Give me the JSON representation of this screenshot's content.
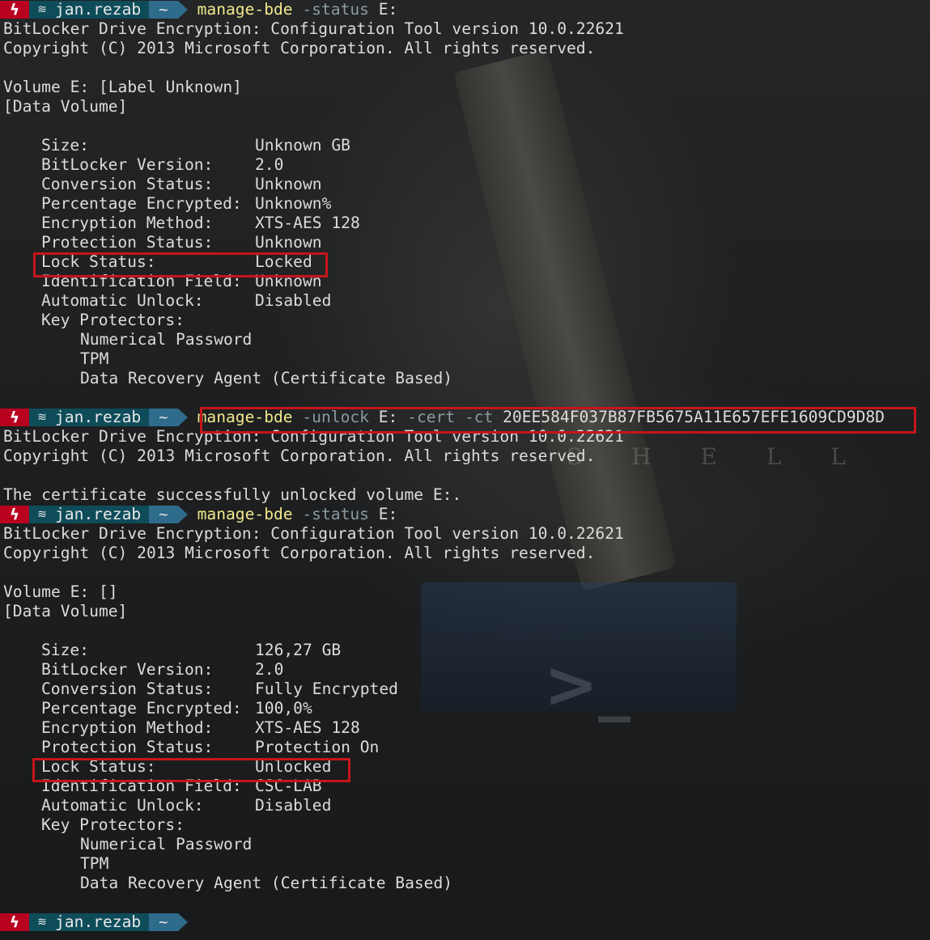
{
  "prompt": {
    "bolt": "ϟ",
    "win": "≋",
    "user": "jan.rezab",
    "home": "~"
  },
  "commands": {
    "status1": {
      "name": "manage-bde",
      "arg": "-status",
      "val": "E:"
    },
    "unlock": {
      "name": "manage-bde",
      "arg1": "-unlock",
      "v1": "E:",
      "arg2": "-cert",
      "arg3": "-ct",
      "v2": "20EE584F037B87FB5675A11E657EFE1609CD9D8D"
    },
    "status2": {
      "name": "manage-bde",
      "arg": "-status",
      "val": "E:"
    }
  },
  "header": {
    "tool": "BitLocker Drive Encryption: Configuration Tool version 10.0.22621",
    "copyright": "Copyright (C) 2013 Microsoft Corporation. All rights reserved."
  },
  "status1": {
    "volume": "Volume E: [Label Unknown]",
    "type": "[Data Volume]",
    "fields": [
      {
        "key": "Size:",
        "value": "Unknown GB"
      },
      {
        "key": "BitLocker Version:",
        "value": "2.0"
      },
      {
        "key": "Conversion Status:",
        "value": "Unknown"
      },
      {
        "key": "Percentage Encrypted:",
        "value": "Unknown%"
      },
      {
        "key": "Encryption Method:",
        "value": "XTS-AES 128"
      },
      {
        "key": "Protection Status:",
        "value": "Unknown"
      },
      {
        "key": "Lock Status:",
        "value": "Locked"
      },
      {
        "key": "Identification Field:",
        "value": "Unknown"
      },
      {
        "key": "Automatic Unlock:",
        "value": "Disabled"
      }
    ],
    "protectors_label": "Key Protectors:",
    "protectors": [
      "Numerical Password",
      "TPM",
      "Data Recovery Agent (Certificate Based)"
    ]
  },
  "unlock_result": "The certificate successfully unlocked volume E:.",
  "status2": {
    "volume": "Volume E: []",
    "type": "[Data Volume]",
    "fields": [
      {
        "key": "Size:",
        "value": "126,27 GB"
      },
      {
        "key": "BitLocker Version:",
        "value": "2.0"
      },
      {
        "key": "Conversion Status:",
        "value": "Fully Encrypted"
      },
      {
        "key": "Percentage Encrypted:",
        "value": "100,0%"
      },
      {
        "key": "Encryption Method:",
        "value": "XTS-AES 128"
      },
      {
        "key": "Protection Status:",
        "value": "Protection On"
      },
      {
        "key": "Lock Status:",
        "value": "Unlocked"
      },
      {
        "key": "Identification Field:",
        "value": "CSC-LAB"
      },
      {
        "key": "Automatic Unlock:",
        "value": "Disabled"
      }
    ],
    "protectors_label": "Key Protectors:",
    "protectors": [
      "Numerical Password",
      "TPM",
      "Data Recovery Agent (Certificate Based)"
    ]
  },
  "background": {
    "watermark": "S H E L L",
    "logo": ">_"
  },
  "colors": {
    "highlight": "#c6151b",
    "command": "#f2e88c",
    "argument": "#8a9aa3",
    "bolt_bg": "#b8001f",
    "user_bg": "#0e4c5a",
    "home_bg": "#2f6b8b"
  }
}
